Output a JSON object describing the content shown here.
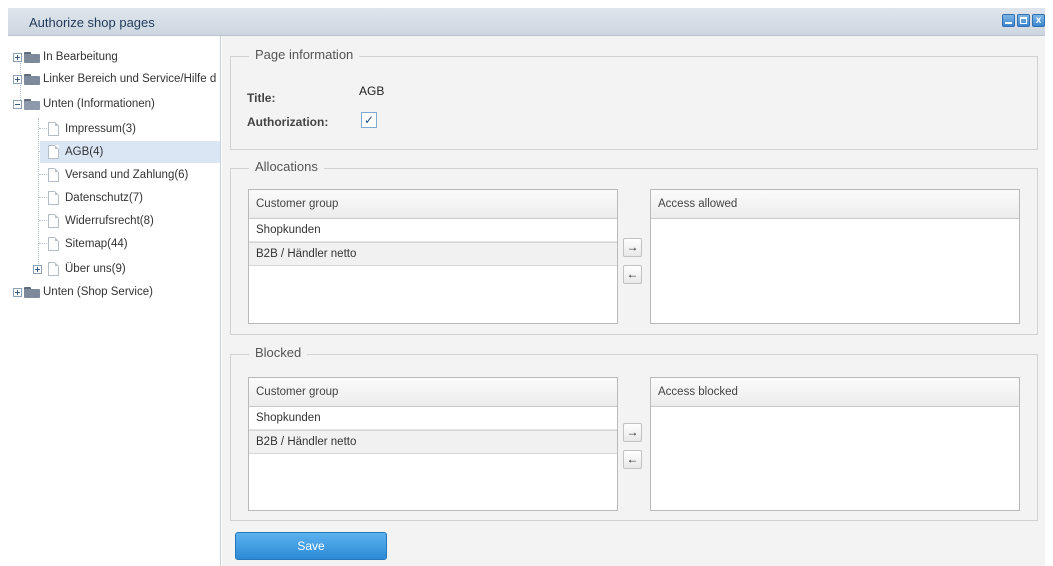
{
  "window": {
    "title": "Authorize shop pages"
  },
  "tree": {
    "items": [
      {
        "label": "In Bearbeitung"
      },
      {
        "label": "Linker Bereich und Service/Hilfe d"
      },
      {
        "label": "Unten (Informationen)"
      },
      {
        "label": "Impressum(3)"
      },
      {
        "label": "AGB(4)"
      },
      {
        "label": "Versand und Zahlung(6)"
      },
      {
        "label": "Datenschutz(7)"
      },
      {
        "label": "Widerrufsrecht(8)"
      },
      {
        "label": "Sitemap(44)"
      },
      {
        "label": "Über uns(9)"
      },
      {
        "label": "Unten (Shop Service)"
      }
    ]
  },
  "page_info": {
    "legend": "Page information",
    "title_label": "Title:",
    "title_value": "AGB",
    "auth_label": "Authorization:",
    "auth_checked": "✓"
  },
  "allocations": {
    "legend": "Allocations",
    "left_header": "Customer group",
    "left_rows": [
      "Shopkunden",
      "B2B / Händler netto"
    ],
    "right_header": "Access allowed",
    "move_right": "→",
    "move_left": "←"
  },
  "blocked": {
    "legend": "Blocked",
    "left_header": "Customer group",
    "left_rows": [
      "Shopkunden",
      "B2B / Händler netto"
    ],
    "right_header": "Access blocked",
    "move_right": "→",
    "move_left": "←"
  },
  "actions": {
    "save_label": "Save"
  },
  "colors": {
    "accent": "#2b8ad6",
    "selected_row": "#dbe6f4"
  }
}
